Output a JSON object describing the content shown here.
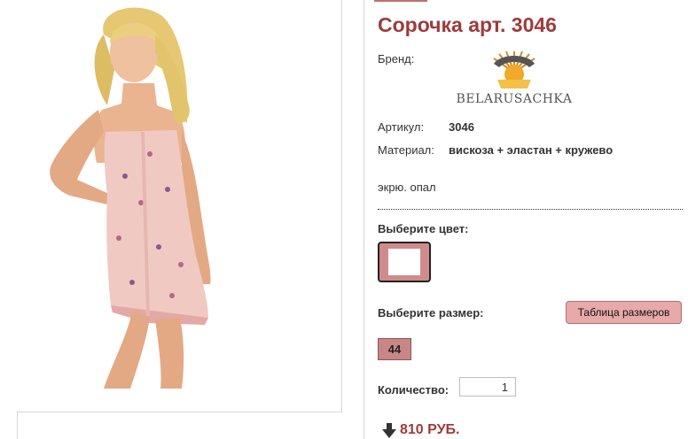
{
  "product": {
    "title": "Сорочка арт. 3046",
    "image_alt": "Сорочка арт. 3046",
    "brand_label": "Бренд:",
    "brand_name": "BELARUSACHKA",
    "article_label": "Артикул:",
    "article_value": "3046",
    "material_label": "Материал:",
    "material_value": "вискоза + эластан + кружево",
    "color_note": "экрю. опал"
  },
  "options": {
    "choose_color_label": "Выберите цвет:",
    "swatch_color": "#d08c8c",
    "choose_size_label": "Выберите размер:",
    "size_table_button": "Таблица размеров",
    "sizes": [
      "44"
    ]
  },
  "quantity": {
    "label": "Количество:",
    "value": "1"
  },
  "price": {
    "value": "810 РУБ.",
    "color": "#9e3b3b"
  },
  "colors": {
    "accent": "#9e3b3b",
    "button_bg": "#e8a9a9",
    "chip_bg": "#c98686"
  },
  "icons": {
    "price": "down-arrow-icon",
    "brand": "sun-logo-icon"
  }
}
